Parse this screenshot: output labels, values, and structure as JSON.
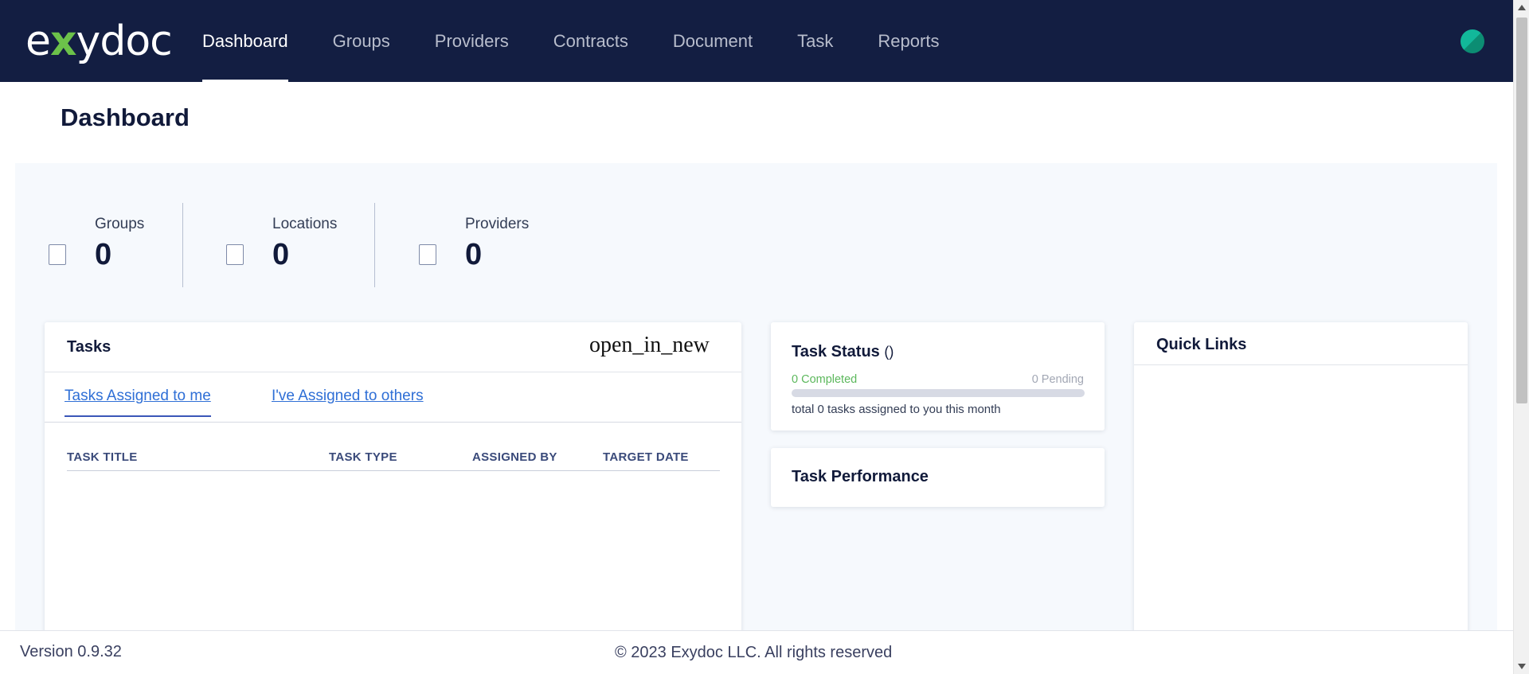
{
  "brand": {
    "logo_pre": "e",
    "logo_x": "x",
    "logo_post": "ydoc"
  },
  "nav": {
    "items": [
      {
        "label": "Dashboard",
        "active": true
      },
      {
        "label": "Groups"
      },
      {
        "label": "Providers"
      },
      {
        "label": "Contracts"
      },
      {
        "label": "Document"
      },
      {
        "label": "Task"
      },
      {
        "label": "Reports"
      }
    ]
  },
  "page": {
    "title": "Dashboard"
  },
  "stats": [
    {
      "label": "Groups",
      "value": "0"
    },
    {
      "label": "Locations",
      "value": "0"
    },
    {
      "label": "Providers",
      "value": "0"
    }
  ],
  "tasks": {
    "title": "Tasks",
    "open_icon_text": "open_in_new",
    "tabs": [
      {
        "label": "Tasks Assigned to me",
        "active": true
      },
      {
        "label": "I've Assigned to others"
      }
    ],
    "columns": [
      "TASK TITLE",
      "TASK TYPE",
      "ASSIGNED BY",
      "TARGET DATE"
    ],
    "rows": []
  },
  "task_status": {
    "title": "Task Status",
    "title_suffix": "()",
    "completed_text": "0 Completed",
    "pending_text": "0 Pending",
    "progress": 0,
    "note": "total 0 tasks assigned to you this month"
  },
  "task_performance": {
    "title": "Task Performance"
  },
  "quick_links": {
    "title": "Quick Links",
    "items": []
  },
  "footer": {
    "version": "Version 0.9.32",
    "copyright": "© 2023 Exydoc LLC. All rights reserved"
  },
  "colors": {
    "header_bg": "#131e42",
    "content_bg": "#f6f9fd",
    "link_blue": "#2f6fd6",
    "success_green": "#5cb85c",
    "logo_accent": "#6cc24a",
    "avatar_teal": "#12b89a"
  }
}
